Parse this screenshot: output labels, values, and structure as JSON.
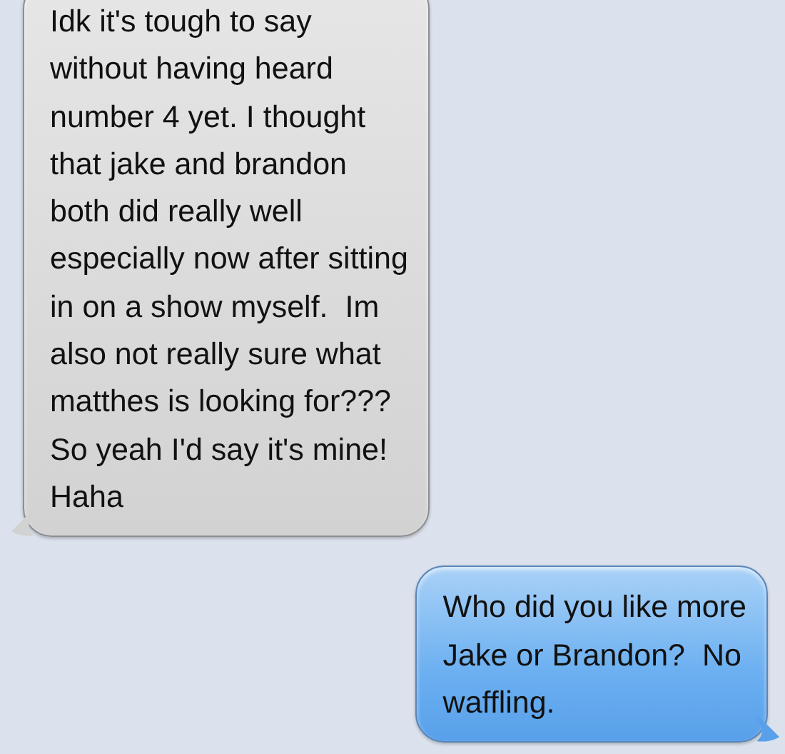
{
  "messages": [
    {
      "kind": "received",
      "text": "Idk it's tough to say\nwithout having heard\nnumber 4 yet. I thought\nthat jake and brandon\nboth did really well\nespecially now after sitting\nin on a show myself.  Im\nalso not really sure what\nmatthes is looking for???\nSo yeah I'd say it's mine!\nHaha"
    },
    {
      "kind": "sent",
      "text": "Who did you like more\nJake or Brandon?  No\nwaffling."
    }
  ]
}
